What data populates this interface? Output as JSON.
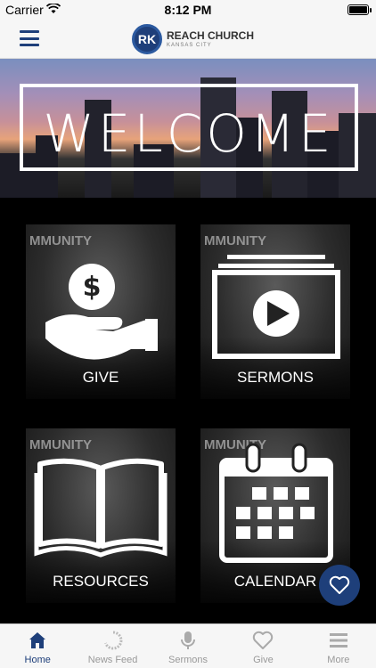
{
  "status": {
    "carrier": "Carrier",
    "time": "8:12 PM"
  },
  "header": {
    "logo_mark": "RK",
    "logo_title": "REACH CHURCH",
    "logo_subtitle": "KANSAS CITY"
  },
  "banner": {
    "text": "WELCOME"
  },
  "tiles": [
    {
      "label": "GIVE",
      "bg_text": "MMUNITY"
    },
    {
      "label": "SERMONS",
      "bg_text": "MMUNITY"
    },
    {
      "label": "RESOURCES",
      "bg_text": "MMUNITY"
    },
    {
      "label": "CALENDAR",
      "bg_text": "MMUNITY"
    }
  ],
  "tabbar": {
    "items": [
      {
        "label": "Home",
        "icon": "home-icon",
        "active": true
      },
      {
        "label": "News Feed",
        "icon": "refresh-icon"
      },
      {
        "label": "Sermons",
        "icon": "microphone-icon"
      },
      {
        "label": "Give",
        "icon": "heart-icon"
      },
      {
        "label": "More",
        "icon": "menu-icon"
      }
    ]
  },
  "colors": {
    "brand": "#1e3f7a",
    "tab_inactive": "#999999"
  }
}
